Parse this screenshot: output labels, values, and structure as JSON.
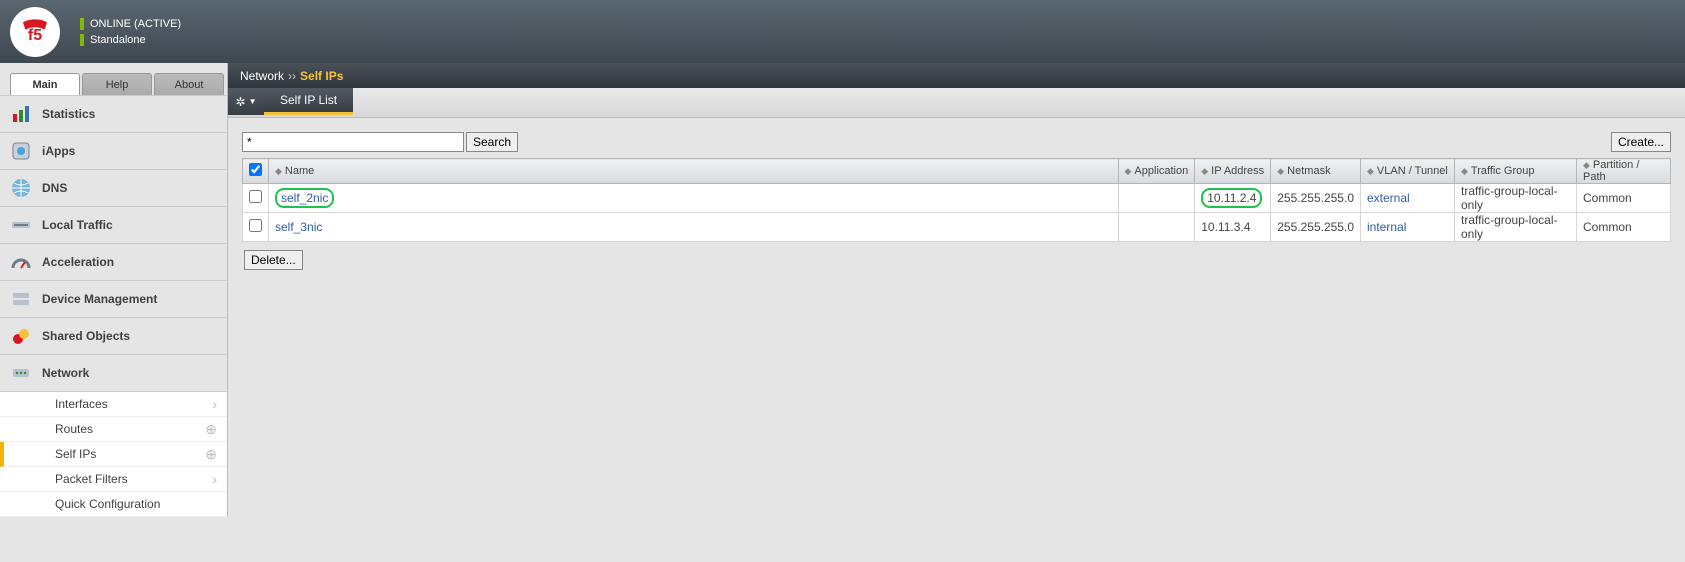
{
  "header": {
    "status1": "ONLINE (ACTIVE)",
    "status2": "Standalone"
  },
  "tabs": {
    "main": "Main",
    "help": "Help",
    "about": "About"
  },
  "nav": {
    "statistics": "Statistics",
    "iapps": "iApps",
    "dns": "DNS",
    "localtraffic": "Local Traffic",
    "acceleration": "Acceleration",
    "devicemgmt": "Device Management",
    "sharedobj": "Shared Objects",
    "network": "Network"
  },
  "subnav": {
    "interfaces": "Interfaces",
    "routes": "Routes",
    "selfips": "Self IPs",
    "packetfilters": "Packet Filters",
    "quickconfig": "Quick Configuration"
  },
  "breadcrumb": {
    "root": "Network",
    "current": "Self IPs"
  },
  "contextTab": "Self IP List",
  "search": {
    "value": "*",
    "button": "Search"
  },
  "createBtn": "Create...",
  "deleteBtn": "Delete...",
  "columns": {
    "name": "Name",
    "application": "Application",
    "ip": "IP Address",
    "netmask": "Netmask",
    "vlan": "VLAN / Tunnel",
    "trafficgroup": "Traffic Group",
    "partition": "Partition / Path"
  },
  "rows": [
    {
      "name": "self_2nic",
      "application": "",
      "ip": "10.11.2.4",
      "netmask": "255.255.255.0",
      "vlan": "external",
      "trafficgroup": "traffic-group-local-only",
      "partition": "Common"
    },
    {
      "name": "self_3nic",
      "application": "",
      "ip": "10.11.3.4",
      "netmask": "255.255.255.0",
      "vlan": "internal",
      "trafficgroup": "traffic-group-local-only",
      "partition": "Common"
    }
  ]
}
